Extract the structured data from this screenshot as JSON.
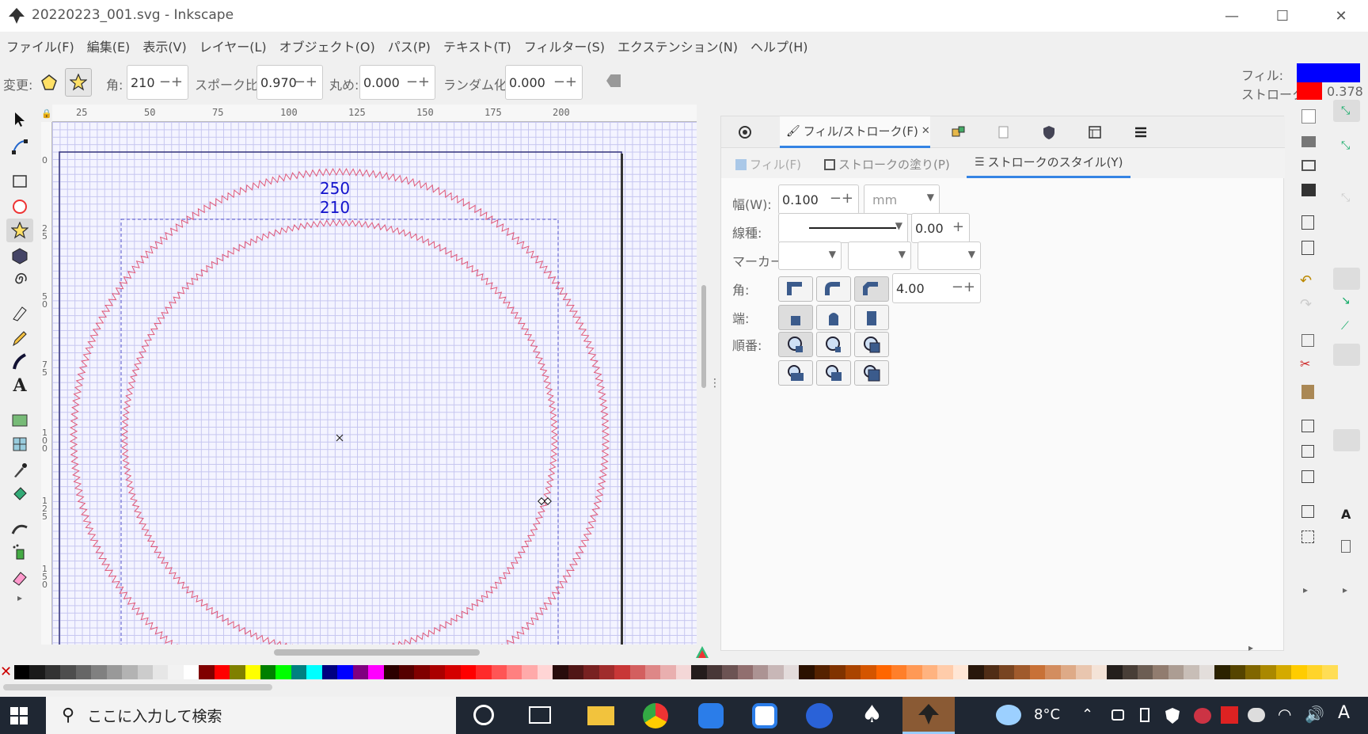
{
  "window": {
    "title": "20220223_001.svg - Inkscape",
    "minimize": "—",
    "maximize": "☐",
    "close": "✕"
  },
  "menu": [
    "ファイル(F)",
    "編集(E)",
    "表示(V)",
    "レイヤー(L)",
    "オブジェクト(O)",
    "パス(P)",
    "テキスト(T)",
    "フィルター(S)",
    "エクステンション(N)",
    "ヘルプ(H)"
  ],
  "controls": {
    "change_label": "変更:",
    "corners_label": "角:",
    "corners_value": "210",
    "spoke_label": "スポーク比:",
    "spoke_value": "0.970",
    "round_label": "丸め:",
    "round_value": "0.000",
    "random_label": "ランダム化:",
    "random_value": "0.000"
  },
  "style_indicator": {
    "fill_label": "フィル:",
    "stroke_label": "ストローク:",
    "stroke_width": "0.378",
    "fill_color": "#0000ff",
    "stroke_color": "#ff0000"
  },
  "ruler_top": [
    "25",
    "50",
    "75",
    "100",
    "125",
    "150",
    "175",
    "200"
  ],
  "ruler_left": [
    "0",
    "2 5",
    "5 0",
    "7 5",
    "1 0 0",
    "1 2 5",
    "1 5 0"
  ],
  "canvas_text": {
    "line1": "250",
    "line2": "210"
  },
  "panel": {
    "tab_active": "フィル/ストローク(F)",
    "tab_close": "✕",
    "subtabs": [
      "フィル(F)",
      "ストロークの塗り(P)",
      "ストロークのスタイル(Y)"
    ],
    "width_label": "幅(W):",
    "width_value": "0.100",
    "unit": "mm",
    "dash_label": "線種:",
    "dash_offset": "0.00",
    "marker_label": "マーカー:",
    "join_label": "角:",
    "miter_value": "4.00",
    "cap_label": "端:",
    "order_label": "順番:"
  },
  "taskbar": {
    "search_placeholder": "ここに入力して検索",
    "weather": "8°C",
    "ime": "A"
  },
  "palette": [
    "#000000",
    "#1a1a1a",
    "#333333",
    "#4d4d4d",
    "#666666",
    "#808080",
    "#999999",
    "#b3b3b3",
    "#cccccc",
    "#e6e6e6",
    "#f2f2f2",
    "#ffffff",
    "#800000",
    "#ff0000",
    "#808000",
    "#ffff00",
    "#008000",
    "#00ff00",
    "#008080",
    "#00ffff",
    "#000080",
    "#0000ff",
    "#800080",
    "#ff00ff",
    "#2b0000",
    "#550000",
    "#800000",
    "#aa0000",
    "#d40000",
    "#ff0000",
    "#ff2a2a",
    "#ff5555",
    "#ff8080",
    "#ffaaaa",
    "#ffd5d5",
    "#280b0b",
    "#501616",
    "#782121",
    "#a02c2c",
    "#c83737",
    "#d35f5f",
    "#de8787",
    "#e9afaf",
    "#f4d7d7",
    "#241c1c",
    "#483737",
    "#6c5353",
    "#916f6f",
    "#ac9393",
    "#c8b7b7",
    "#e3dbdb",
    "#2b1100",
    "#552200",
    "#803300",
    "#aa4400",
    "#d45500",
    "#ff6600",
    "#ff7f2a",
    "#ff9955",
    "#ffb380",
    "#ffccaa",
    "#ffe6d5",
    "#28170b",
    "#502d16",
    "#784421",
    "#a05a2c",
    "#c87137",
    "#d38d5f",
    "#deaa87",
    "#e9c6af",
    "#f4e3d7",
    "#241f1c",
    "#483e37",
    "#6c5d53",
    "#917c6f",
    "#ac9d93",
    "#c8beb7",
    "#e3dedb",
    "#2b2200",
    "#554400",
    "#806600",
    "#aa8800",
    "#d4aa00",
    "#ffcc00",
    "#ffd42a",
    "#ffdd55"
  ]
}
